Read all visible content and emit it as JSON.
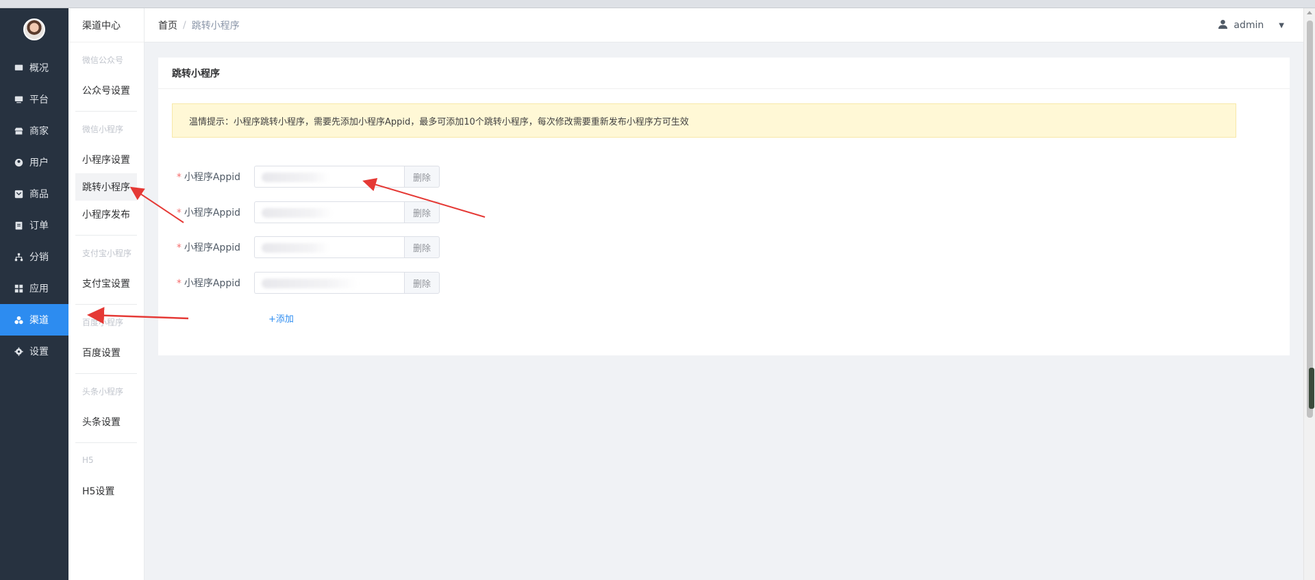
{
  "sidebar": {
    "items": [
      {
        "label": "概况",
        "icon": "dashboard-icon"
      },
      {
        "label": "平台",
        "icon": "monitor-icon"
      },
      {
        "label": "商家",
        "icon": "store-icon"
      },
      {
        "label": "用户",
        "icon": "user-icon"
      },
      {
        "label": "商品",
        "icon": "goods-icon"
      },
      {
        "label": "订单",
        "icon": "order-icon"
      },
      {
        "label": "分销",
        "icon": "distribution-icon"
      },
      {
        "label": "应用",
        "icon": "apps-icon"
      },
      {
        "label": "渠道",
        "icon": "channel-icon",
        "active": true
      },
      {
        "label": "设置",
        "icon": "gear-icon"
      }
    ],
    "active_color": "#2d8cf0",
    "bg_color": "#273240"
  },
  "subside": {
    "title": "渠道中心",
    "groups": [
      {
        "label": "微信公众号",
        "items": [
          "公众号设置"
        ]
      },
      {
        "label": "微信小程序",
        "items": [
          "小程序设置",
          "跳转小程序",
          "小程序发布"
        ]
      },
      {
        "label": "支付宝小程序",
        "items": [
          "支付宝设置"
        ]
      },
      {
        "label": "百度小程序",
        "items": [
          "百度设置"
        ]
      },
      {
        "label": "头条小程序",
        "items": [
          "头条设置"
        ]
      },
      {
        "label": "H5",
        "items": [
          "H5设置"
        ]
      }
    ],
    "active_item": "跳转小程序"
  },
  "header": {
    "breadcrumb_home": "首页",
    "breadcrumb_sep": "/",
    "breadcrumb_current": "跳转小程序",
    "username": "admin"
  },
  "card": {
    "title": "跳转小程序",
    "notice": "温情提示：小程序跳转小程序，需要先添加小程序Appid，最多可添加10个跳转小程序，每次修改需要重新发布小程序方可生效",
    "field_label": "小程序Appid",
    "required_mark": "*",
    "delete_label": "删除",
    "add_label": "+添加",
    "notice_bg": "#fff8d6"
  }
}
